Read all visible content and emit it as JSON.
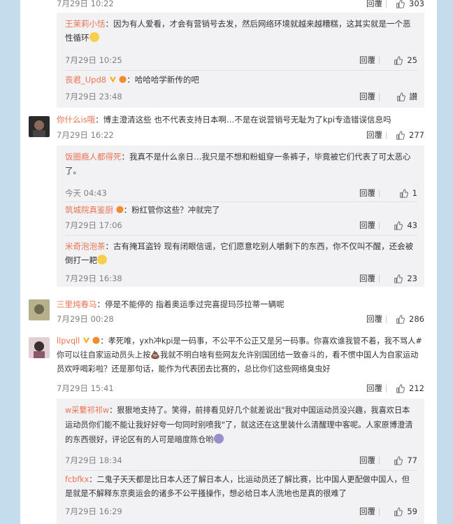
{
  "ui": {
    "reply_label": "回覆",
    "like_icon": "thumbs-up-icon"
  },
  "top": {
    "time": "7月29日 10:22",
    "likes": "303"
  },
  "comments": [
    {
      "replies": [
        {
          "user": "王茉莉小恬",
          "text": "：因为有人爱看，才会有营销号去发，然后网络环境就越来越糟糕，这其实就是一个恶性循环",
          "time": "7月29日 10:25",
          "likes": "25"
        },
        {
          "user": "丧君_Upd8",
          "text": "：哈哈哈学新传的吧",
          "time": "7月29日 23:48",
          "likes": "讃"
        }
      ]
    },
    {
      "user": "你什么is哦",
      "text": "：博主澄清这些 也不代表支持日本啊…不是在说营销号无耻为了kpi专造错误信息吗",
      "time": "7月29日 16:22",
      "likes": "277",
      "replies": [
        {
          "user": "饭圈瘾人都得死",
          "text": "：我真不是什么亲日…我只是不想和粉蛆穿一条裤子，毕竟被它们代表了可太恶心了。",
          "time": "今天 04:43",
          "likes": "1"
        },
        {
          "user": "筑城院真鉴厨",
          "text": "：粉红管你这些？冲就完了",
          "time": "7月29日 17:06",
          "likes": "43"
        },
        {
          "user": "米奇泡泡茶",
          "text": "：古有掩耳盗铃 现有闭眼信谣，它们愿意吃别人嚼剩下的东西，你不仅叫不醒，还会被倒打一耙",
          "time": "7月29日 16:38",
          "likes": "23"
        }
      ]
    },
    {
      "user": "三里炖春马",
      "text": "：停是不能停的 指着奥运季过完喜提玛莎拉蒂一辆呢",
      "time": "7月29日 00:28",
      "likes": "286"
    },
    {
      "user": "llpvqll",
      "text": "：孝死唯，yxh冲kpi是一码事，不公平不公正又是另一码事。你喜欢谁我管不着，我不骂人#你可以往自家运动员头上按💩我就不明白啥有些网友允许别国团结一致奋斗的，看不惯中国人为自家运动员欢呼喝彩啦？还是那句话，能作为代表团去比赛的，总比你们这些网络臭虫好",
      "time": "7月29日 15:41",
      "likes": "212",
      "replies": [
        {
          "user": "w采蘩祁祁w",
          "text": "：狠狠地支持了。笑得，前排看见好几个就差说出\"我对中国运动员没兴趣，我喜欢日本运动员你们能不能让我好好夸一句同时别喷我\"了，就这还在这里装什么清醒理中客呢。人家原博澄清的东西很好，评论区有的人可是暗度陈仓哟",
          "time": "7月29日 18:34",
          "likes": "77"
        },
        {
          "user": "fcbfkx",
          "text": "：二鬼子天天都是比日本人还了解日本人，比运动员还了解比赛，比中国人更配做中国人，但是就是不解释东京奥运会的诸多不公平搔操作，想必给日本人洗地也是真的很难了",
          "time": "7月29日 16:29",
          "likes": "59"
        }
      ]
    }
  ]
}
